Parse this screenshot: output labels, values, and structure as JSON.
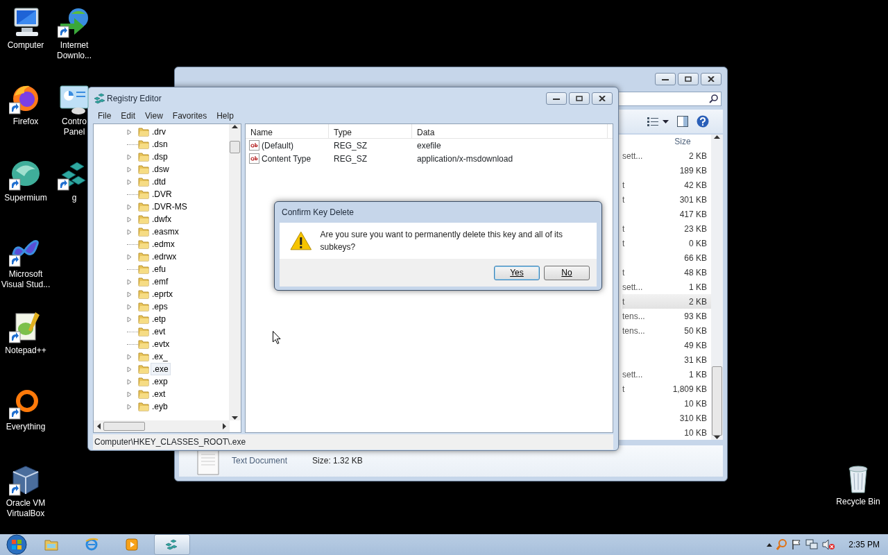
{
  "desktop": {
    "columns": [
      [
        {
          "kind": "computer",
          "label": "Computer",
          "shortcut": false
        },
        {
          "kind": "firefox",
          "label": "Firefox",
          "shortcut": true
        },
        {
          "kind": "supermium",
          "label": "Supermium",
          "shortcut": true
        },
        {
          "kind": "visual-studio",
          "label": "Microsoft Visual Stud...",
          "shortcut": true
        },
        {
          "kind": "notepad",
          "label": "Notepad++",
          "shortcut": true
        },
        {
          "kind": "everything",
          "label": "Everything",
          "shortcut": true
        },
        {
          "kind": "virtualbox",
          "label": "Oracle VM VirtualBox",
          "shortcut": true
        }
      ],
      [
        {
          "kind": "downloader",
          "label": "Internet Downlo...",
          "shortcut": true
        },
        {
          "kind": "control-panel",
          "label": "Contro Panel",
          "shortcut": false
        },
        {
          "kind": "registry",
          "label": "g",
          "shortcut": true
        }
      ]
    ],
    "recycle_bin": {
      "label": "Recycle Bin"
    }
  },
  "explorer": {
    "size_header": "Size",
    "rows": [
      {
        "type": "sett...",
        "size": "2 KB",
        "selected": false
      },
      {
        "type": "",
        "size": "189 KB",
        "selected": false
      },
      {
        "type": "t",
        "size": "42 KB",
        "selected": false
      },
      {
        "type": "t",
        "size": "301 KB",
        "selected": false
      },
      {
        "type": "",
        "size": "417 KB",
        "selected": false
      },
      {
        "type": "t",
        "size": "23 KB",
        "selected": false
      },
      {
        "type": "t",
        "size": "0 KB",
        "selected": false
      },
      {
        "type": "",
        "size": "66 KB",
        "selected": false
      },
      {
        "type": "t",
        "size": "48 KB",
        "selected": false
      },
      {
        "type": "sett...",
        "size": "1 KB",
        "selected": false
      },
      {
        "type": "t",
        "size": "2 KB",
        "selected": true
      },
      {
        "type": "tens...",
        "size": "93 KB",
        "selected": false
      },
      {
        "type": "tens...",
        "size": "50 KB",
        "selected": false
      },
      {
        "type": "",
        "size": "49 KB",
        "selected": false
      },
      {
        "type": "",
        "size": "31 KB",
        "selected": false
      },
      {
        "type": "sett...",
        "size": "1 KB",
        "selected": false
      },
      {
        "type": "t",
        "size": "1,809 KB",
        "selected": false
      },
      {
        "type": "",
        "size": "10 KB",
        "selected": false
      },
      {
        "type": "",
        "size": "310 KB",
        "selected": false
      },
      {
        "type": "",
        "size": "10 KB",
        "selected": false
      }
    ],
    "details": {
      "file_type": "Text Document",
      "size": "Size: 1.32 KB"
    }
  },
  "registry_editor": {
    "title": "Registry Editor",
    "menu": [
      "File",
      "Edit",
      "View",
      "Favorites",
      "Help"
    ],
    "tree": [
      {
        "label": ".drv",
        "expandable": true,
        "selected": false
      },
      {
        "label": ".dsn",
        "expandable": false,
        "selected": false
      },
      {
        "label": ".dsp",
        "expandable": true,
        "selected": false
      },
      {
        "label": ".dsw",
        "expandable": true,
        "selected": false
      },
      {
        "label": ".dtd",
        "expandable": true,
        "selected": false
      },
      {
        "label": ".DVR",
        "expandable": false,
        "selected": false
      },
      {
        "label": ".DVR-MS",
        "expandable": true,
        "selected": false
      },
      {
        "label": ".dwfx",
        "expandable": true,
        "selected": false
      },
      {
        "label": ".easmx",
        "expandable": true,
        "selected": false
      },
      {
        "label": ".edmx",
        "expandable": false,
        "selected": false
      },
      {
        "label": ".edrwx",
        "expandable": true,
        "selected": false
      },
      {
        "label": ".efu",
        "expandable": false,
        "selected": false
      },
      {
        "label": ".emf",
        "expandable": true,
        "selected": false
      },
      {
        "label": ".eprtx",
        "expandable": true,
        "selected": false
      },
      {
        "label": ".eps",
        "expandable": true,
        "selected": false
      },
      {
        "label": ".etp",
        "expandable": true,
        "selected": false
      },
      {
        "label": ".evt",
        "expandable": false,
        "selected": false
      },
      {
        "label": ".evtx",
        "expandable": false,
        "selected": false
      },
      {
        "label": ".ex_",
        "expandable": true,
        "selected": false
      },
      {
        "label": ".exe",
        "expandable": true,
        "selected": true
      },
      {
        "label": ".exp",
        "expandable": true,
        "selected": false
      },
      {
        "label": ".ext",
        "expandable": true,
        "selected": false
      },
      {
        "label": ".eyb",
        "expandable": true,
        "selected": false
      }
    ],
    "columns": [
      "Name",
      "Type",
      "Data"
    ],
    "values": [
      {
        "name": "(Default)",
        "type": "REG_SZ",
        "data": "exefile"
      },
      {
        "name": "Content Type",
        "type": "REG_SZ",
        "data": "application/x-msdownload"
      }
    ],
    "status_bar": "Computer\\HKEY_CLASSES_ROOT\\.exe"
  },
  "dialog": {
    "title": "Confirm Key Delete",
    "message": "Are you sure you want to permanently delete this key and all of its subkeys?",
    "buttons": [
      {
        "label": "Yes",
        "default": true
      },
      {
        "label": "No",
        "default": false
      }
    ]
  },
  "taskbar": {
    "items": [
      {
        "kind": "explorer",
        "active": false
      },
      {
        "kind": "browser",
        "active": false
      },
      {
        "kind": "media",
        "active": false
      },
      {
        "kind": "registry",
        "active": true
      }
    ],
    "clock": "2:35 PM"
  }
}
